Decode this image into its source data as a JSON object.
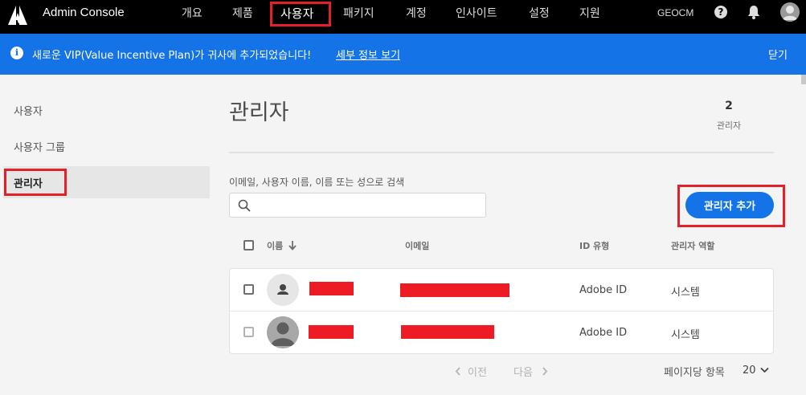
{
  "app": {
    "title": "Admin Console"
  },
  "nav": {
    "items": [
      {
        "label": "개요"
      },
      {
        "label": "제품"
      },
      {
        "label": "사용자"
      },
      {
        "label": "패키지"
      },
      {
        "label": "계정"
      },
      {
        "label": "인사이트"
      },
      {
        "label": "설정"
      },
      {
        "label": "지원"
      }
    ],
    "active_index": 2,
    "org": "GEOCM"
  },
  "banner": {
    "text": "새로운 VIP(Value Incentive Plan)가 귀사에 추가되었습니다!",
    "link": "세부 정보 보기",
    "close": "닫기"
  },
  "sidebar": {
    "items": [
      {
        "label": "사용자"
      },
      {
        "label": "사용자 그룹"
      },
      {
        "label": "관리자"
      }
    ],
    "active_index": 2
  },
  "main": {
    "title": "관리자",
    "count": {
      "value": "2",
      "label": "관리자"
    },
    "search": {
      "label": "이메일, 사용자 이름, 이름 또는 성으로 검색",
      "value": ""
    },
    "add_button": "관리자 추가",
    "table": {
      "headers": {
        "name": "이름",
        "email": "이메일",
        "id_type": "ID 유형",
        "role": "관리자 역할"
      },
      "rows": [
        {
          "id_type": "Adobe ID",
          "role": "시스템"
        },
        {
          "id_type": "Adobe ID",
          "role": "시스템"
        }
      ]
    },
    "pagination": {
      "prev": "이전",
      "next": "다음",
      "per_page_label": "페이지당 항목",
      "per_page_value": "20"
    }
  },
  "colors": {
    "nav_bg": "#000000",
    "banner_bg": "#1473e6",
    "accent": "#1473e6",
    "highlight_box": "#e5202b",
    "redaction": "#ed1c24"
  }
}
